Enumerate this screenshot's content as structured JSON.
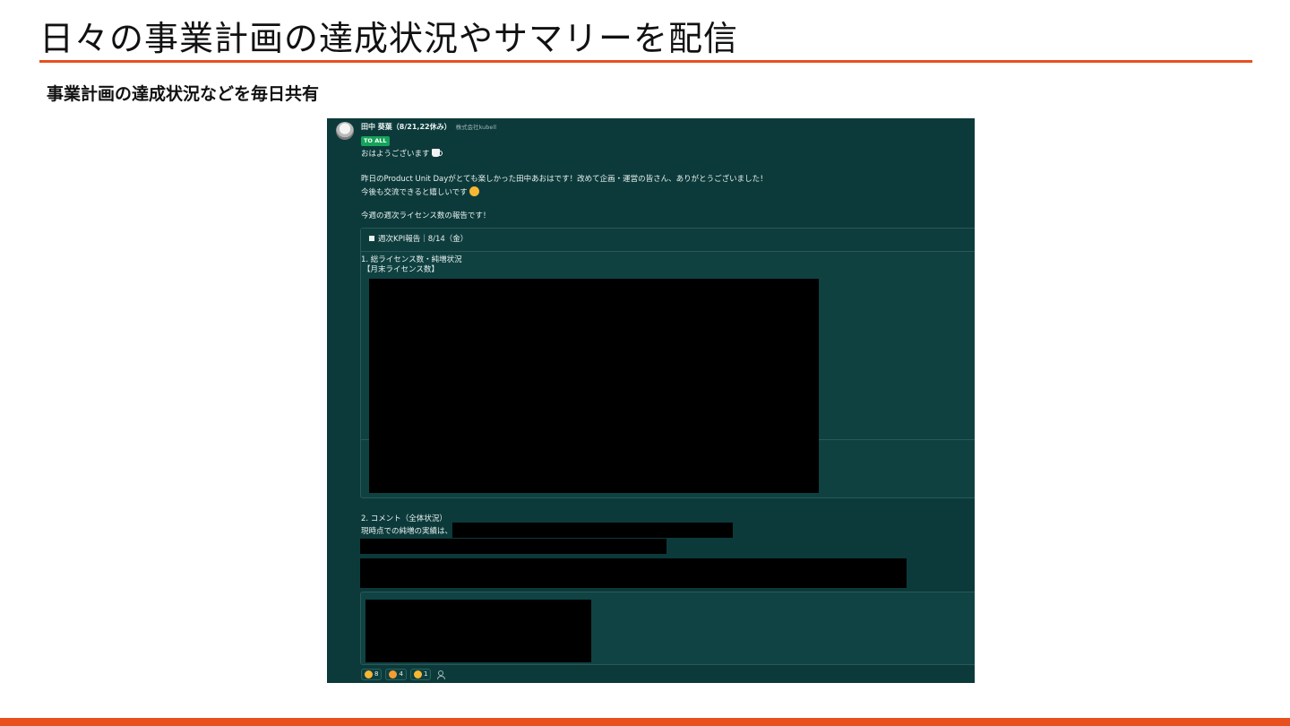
{
  "slide": {
    "title": "日々の事業計画の達成状況やサマリーを配信",
    "subtitle": "事業計画の達成状況などを毎日共有",
    "accent_color": "#e8501f"
  },
  "chat": {
    "sender": "田中 葵葉（8/21,22休み）",
    "company": "株式会社kubell",
    "mention_badge": "TO ALL",
    "greeting": "おはようございます",
    "line1": "昨日のProduct Unit Dayがとても楽しかった田中あおはです！改めて企画・運営の皆さん、ありがとうございました！",
    "line2": "今後も交流できると嬉しいです",
    "line3": "今週の週次ライセンス数の報告です！",
    "kpi_header": "週次KPI報告｜8/14（金）",
    "section1_title": "1. 総ライセンス数・純増状況",
    "section1_sub": "【月末ライセンス数】",
    "section2_title": "2. コメント（全体状況）",
    "section2_text": "現時点での純増の実績は、",
    "reactions": [
      {
        "icon": "grimace-emoji-icon",
        "count": "8"
      },
      {
        "icon": "bow-emoji-icon",
        "count": "4"
      },
      {
        "icon": "smile-emoji-icon",
        "count": "1"
      }
    ],
    "colors": {
      "background": "#0c3a3a",
      "badge": "#15a35a"
    }
  }
}
